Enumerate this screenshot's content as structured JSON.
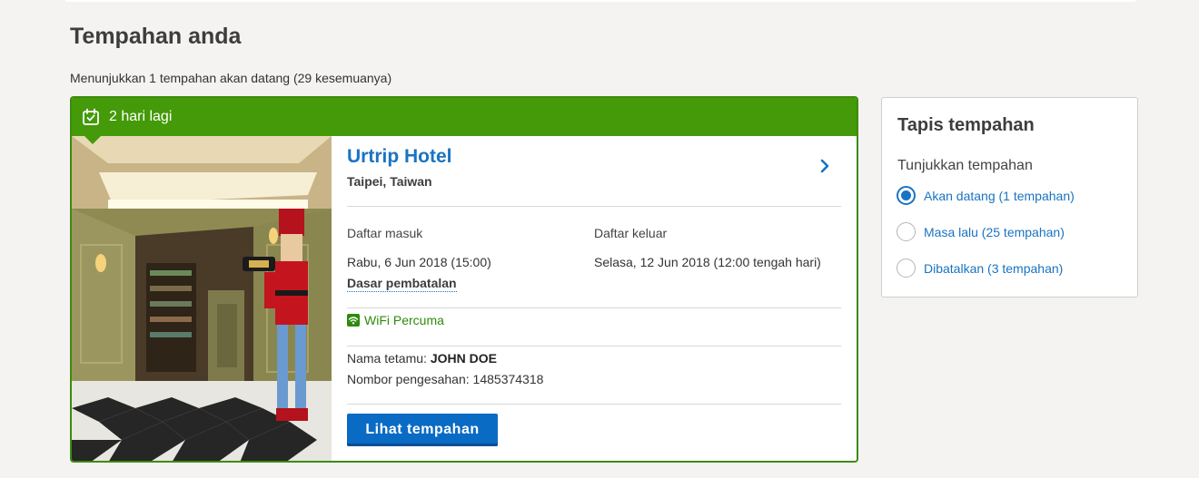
{
  "page": {
    "title": "Tempahan anda",
    "summary": "Menunjukkan 1 tempahan akan datang (29 kesemuanya)"
  },
  "booking": {
    "countdown": "2 hari lagi",
    "hotel_name": "Urtrip Hotel",
    "location": "Taipei, Taiwan",
    "checkin_label": "Daftar masuk",
    "checkin_value": "Rabu, 6 Jun 2018 (15:00)",
    "checkout_label": "Daftar keluar",
    "checkout_value": "Selasa, 12 Jun 2018 (12:00 tengah hari)",
    "cancellation_link": "Dasar pembatalan",
    "amenity": "WiFi Percuma",
    "guest_label": "Nama tetamu:",
    "guest_name": "JOHN DOE",
    "confirmation_label": "Nombor pengesahan:",
    "confirmation_number": "1485374318",
    "view_button": "Lihat tempahan"
  },
  "filter": {
    "title": "Tapis tempahan",
    "subtitle": "Tunjukkan tempahan",
    "options": [
      {
        "label": "Akan datang (1 tempahan)",
        "selected": true
      },
      {
        "label": "Masa lalu (25 tempahan)",
        "selected": false
      },
      {
        "label": "Dibatalkan (3 tempahan)",
        "selected": false
      }
    ]
  },
  "colors": {
    "accent_green": "#449a08",
    "link_blue": "#1a73c2",
    "button_blue": "#0a6bc4"
  },
  "icons": {
    "header": "calendar-check-icon",
    "hotel_arrow": "chevron-right-icon",
    "amenity": "wifi-icon"
  }
}
